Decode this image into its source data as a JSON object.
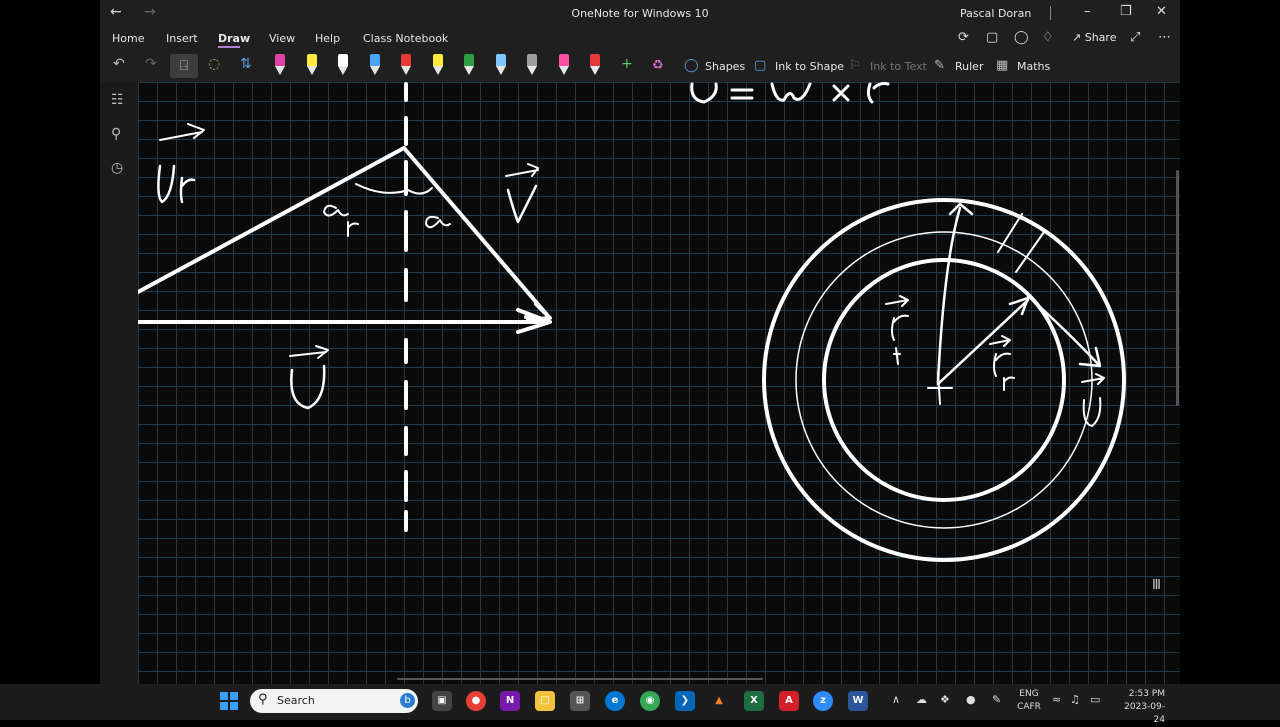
{
  "titlebar": {
    "title": "OneNote for Windows 10",
    "user": "Pascal Doran"
  },
  "menu": {
    "tabs": [
      "Home",
      "Insert",
      "Draw",
      "View",
      "Help",
      "Class Notebook"
    ],
    "active": "Draw",
    "share_label": "Share"
  },
  "toolbar": {
    "shapes_label": "Shapes",
    "ink_to_shape_label": "Ink to Shape",
    "ink_to_text_label": "Ink to Text",
    "ruler_label": "Ruler",
    "maths_label": "Maths",
    "pen_colors": [
      "#e040a0",
      "#ffeb3b",
      "#ffffff",
      "#4aa3ff",
      "#e53935",
      "#ffeb3b",
      "#2e9e44",
      "#7ec8ff",
      "#9e9e9e",
      "#ff4fa3",
      "#e53935"
    ],
    "accent_color": "#b57fd8"
  },
  "taskbar": {
    "search_placeholder": "Search",
    "lang_line1": "ENG",
    "lang_line2": "CAFR",
    "time": "2:53 PM",
    "date": "2023-09-24"
  },
  "canvas": {
    "background_color": "#0a0a0a",
    "grid_color": "#1f3a4d",
    "ink_color": "#ffffff"
  }
}
